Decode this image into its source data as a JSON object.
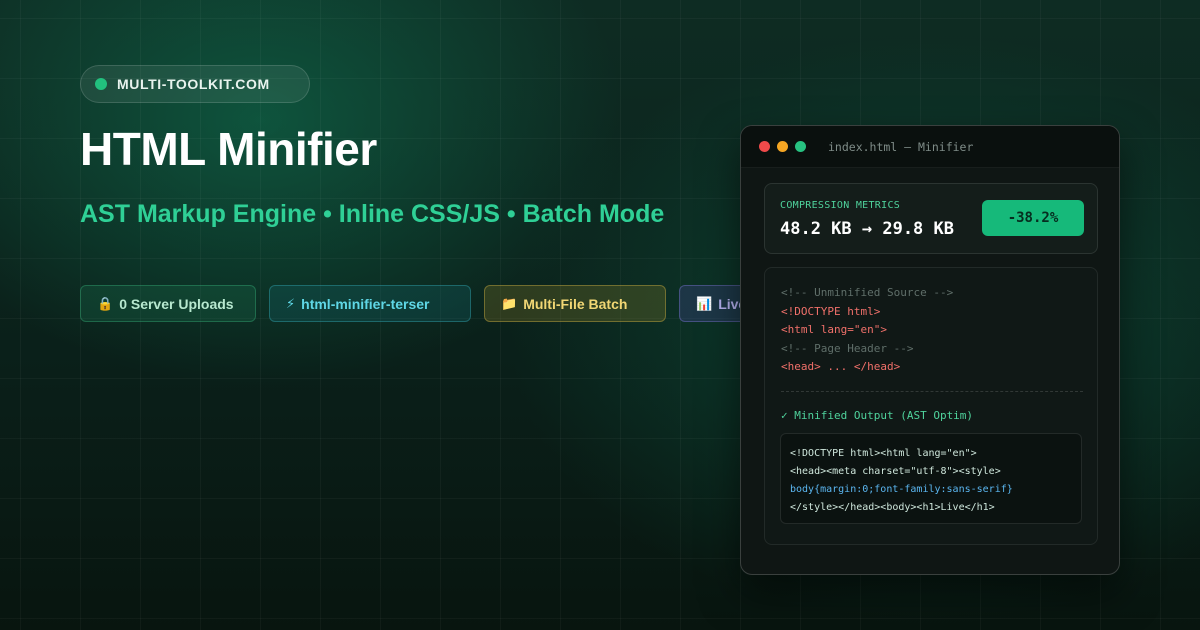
{
  "brand": {
    "label": "MULTI-TOOLKIT.COM",
    "dot_color": "#22c07e"
  },
  "hero": {
    "title": "HTML Minifier",
    "subtitle": "AST Markup Engine • Inline CSS/JS • Batch Mode"
  },
  "badges": [
    {
      "icon": "lock-icon",
      "glyph": "🔒",
      "label": "0 Server Uploads"
    },
    {
      "icon": "lightning-icon",
      "glyph": "⚡",
      "label": "html-minifier-terser"
    },
    {
      "icon": "folder-icon",
      "glyph": "📁",
      "label": "Multi-File Batch"
    },
    {
      "icon": "chart-icon",
      "glyph": "📊",
      "label": "Live"
    }
  ],
  "window": {
    "title": "index.html — Minifier",
    "metrics": {
      "label": "COMPRESSION METRICS",
      "value": "48.2 KB → 29.8 KB",
      "reduction": "-38.2%"
    },
    "source": {
      "lines": [
        "<!-- Unminified Source -->",
        "<!DOCTYPE html>",
        "<html lang=\"en\">",
        "<!-- Page Header -->",
        "<head> ... </head>"
      ]
    },
    "output": {
      "heading": "✓ Minified Output (AST Optim)",
      "lines": [
        "<!DOCTYPE html><html lang=\"en\">",
        "<head><meta charset=\"utf-8\"><style>",
        "body{margin:0;font-family:sans-serif}",
        "</style></head><body><h1>Live</h1>"
      ]
    }
  },
  "colors": {
    "accent": "#2fd096",
    "reduction_badge": "#16b97a",
    "tag": "#f0706a",
    "css": "#5bb6f0"
  }
}
